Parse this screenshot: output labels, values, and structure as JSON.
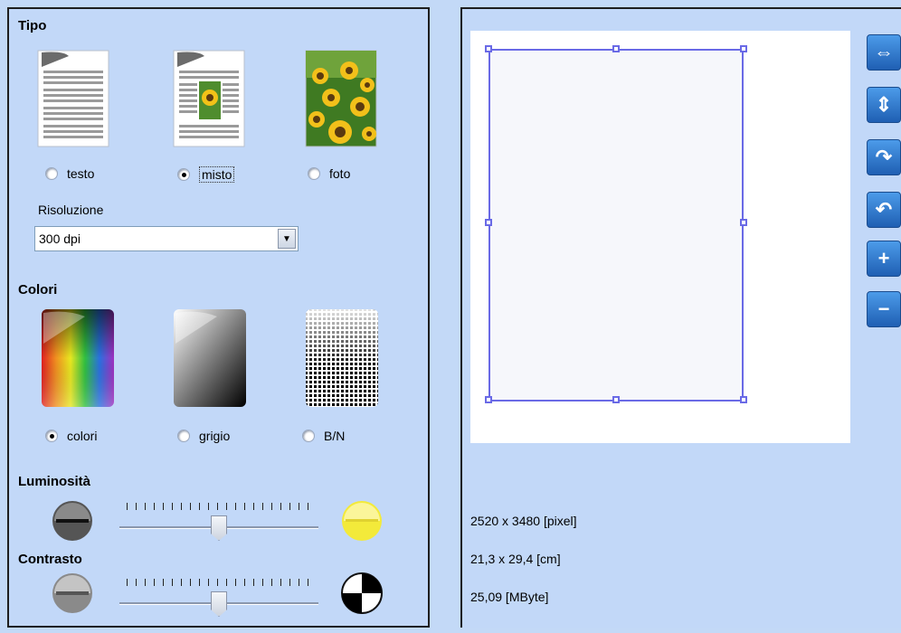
{
  "tipo": {
    "title": "Tipo",
    "options": [
      {
        "label": "testo",
        "selected": false
      },
      {
        "label": "misto",
        "selected": true
      },
      {
        "label": "foto",
        "selected": false
      }
    ]
  },
  "risoluzione": {
    "label": "Risoluzione",
    "value": "300 dpi"
  },
  "colori": {
    "title": "Colori",
    "options": [
      {
        "label": "colori",
        "selected": true
      },
      {
        "label": "grigio",
        "selected": false
      },
      {
        "label": "B/N",
        "selected": false
      }
    ]
  },
  "luminosita": {
    "title": "Luminosità",
    "level": 0.5
  },
  "contrasto": {
    "title": "Contrasto",
    "level": 0.5
  },
  "info": {
    "pixel": "2520 x 3480 [pixel]",
    "cm": "21,3 x 29,4 [cm]",
    "size": "25,09 [MByte]"
  },
  "toolbar": {
    "icons": [
      "fit-width-icon",
      "fit-height-icon",
      "rotate-right-icon",
      "rotate-left-icon",
      "zoom-in-icon",
      "zoom-out-icon"
    ]
  },
  "colors": {
    "panel_bg": "#c2d8f8",
    "crop_border": "#6a6ae6",
    "tool_blue": "#2f7ad0"
  }
}
